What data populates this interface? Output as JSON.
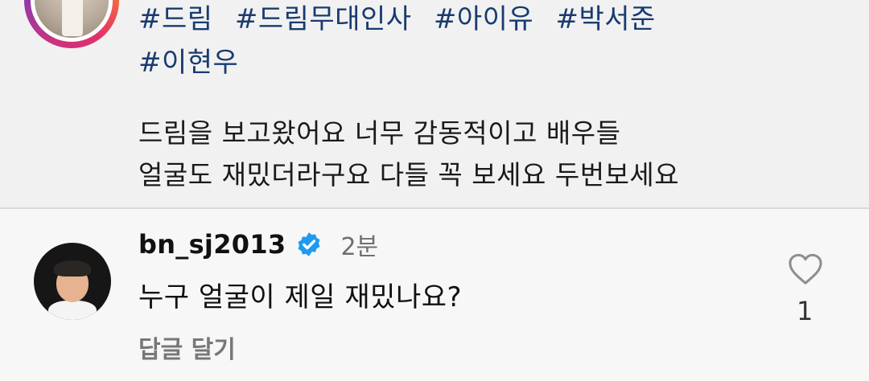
{
  "post": {
    "hashtags_line1": [
      "#드림",
      "#드림무대인사",
      "#아이유",
      "#박서준"
    ],
    "hashtags_line2": [
      "#이현우"
    ],
    "caption_line1": "드림을 보고왔어요 너무 감동적이고 배우들",
    "caption_line2": "얼굴도 재밌더라구요 다들 꼭 보세요 두번보세요"
  },
  "comment": {
    "username": "bn_sj2013",
    "verified": true,
    "time": "2분",
    "text": "누구 얼굴이 제일 재밌나요?",
    "reply_label": "답글 달기",
    "like_count": "1",
    "like_icon": "heart-outline-icon",
    "verified_color": "#1d9bf0"
  }
}
